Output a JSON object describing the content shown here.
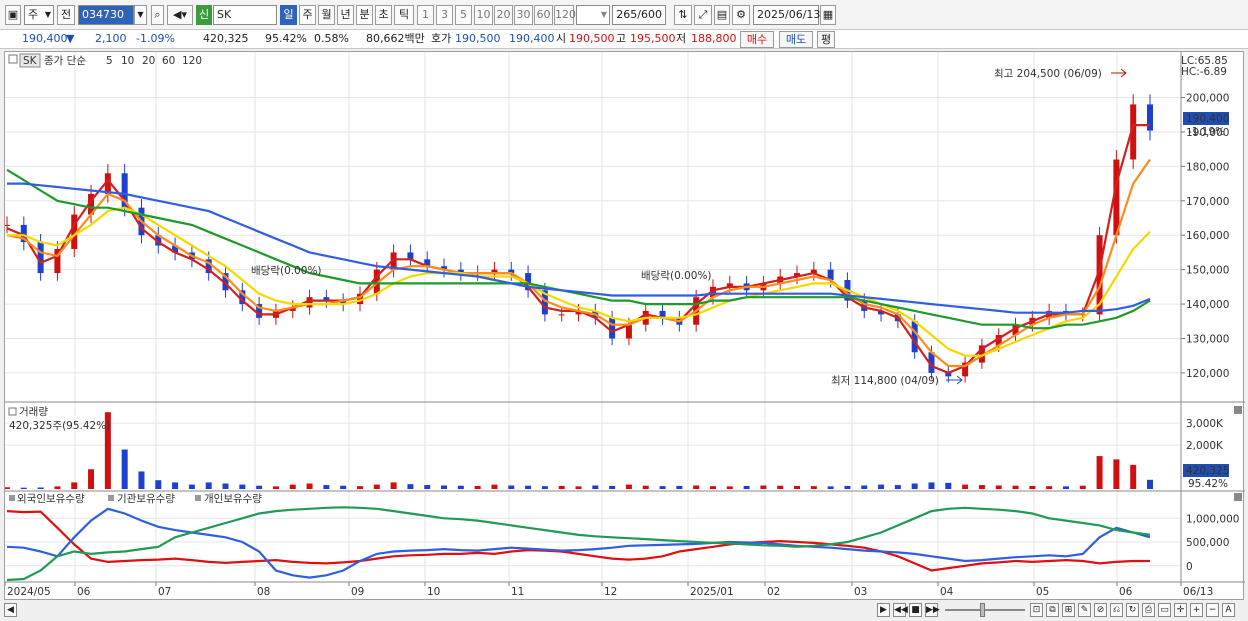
{
  "toolbar": {
    "period_type": "주",
    "prev_label": "전",
    "stock_code": "034730",
    "stock_name": "SK",
    "new_badge": "신",
    "period_buttons": [
      "일",
      "주",
      "월",
      "년",
      "분",
      "초",
      "틱"
    ],
    "interval_buttons": [
      "1",
      "3",
      "5",
      "10",
      "20",
      "30",
      "60",
      "120"
    ],
    "count_value": "265",
    "count_total": "/600",
    "date": "2025/06/13"
  },
  "info": {
    "price": "190,400",
    "change": "▼",
    "change_amount": "2,100",
    "change_pct": "-1.09%",
    "volume": "420,325",
    "volume_ratio": "95.42%",
    "turnover_rate": "0.58%",
    "amount": "80,662백만",
    "bid_label": "호가",
    "bid1": "190,500",
    "bid2": "190,400",
    "open_label": "시",
    "open": "190,500",
    "high_label": "고",
    "high": "195,500",
    "low_label": "저",
    "low": "188,800",
    "buy_button": "매수",
    "sell_button": "매도",
    "eval_button": "평"
  },
  "price_panel": {
    "legend_box": "SK",
    "legend_title": "종가 단순",
    "ma_periods": [
      "5",
      "10",
      "20",
      "60",
      "120"
    ],
    "lc": "LC:65.85",
    "hc": "HC:-6.89",
    "current_price": "190,400",
    "current_pct": "-1.19%",
    "max_label": "최고 204,500 (06/09)",
    "min_label": "최저 114,800 (04/09)",
    "dividend_labels": [
      "배당락(0.00%)",
      "배당락(0.00%)"
    ]
  },
  "volume_panel": {
    "title": "거래량",
    "value": "420,325주(95.42%)",
    "current": "420,325",
    "current_pct": "95.42%"
  },
  "holdings_panel": {
    "series_names": [
      "외국인보유수량",
      "기관보유수량",
      "개인보유수량"
    ]
  },
  "x_labels": [
    "2024/05",
    "06",
    "07",
    "08",
    "09",
    "10",
    "11",
    "12",
    "2025/01",
    "02",
    "03",
    "04",
    "05",
    "06",
    "06/13"
  ],
  "chart_data": [
    {
      "type": "line",
      "yticks": [
        "200,000",
        "190,000",
        "180,000",
        "170,000",
        "160,000",
        "150,000",
        "140,000",
        "130,000",
        "120,000"
      ],
      "ylim": [
        113000,
        208000
      ],
      "series": [
        {
          "name": "종가",
          "color": "#1e40d0",
          "values": [
            163000,
            158000,
            149000,
            156000,
            166000,
            172000,
            178000,
            168000,
            160000,
            157000,
            155000,
            153000,
            149000,
            144000,
            140000,
            136000,
            138000,
            139000,
            142000,
            141000,
            140000,
            143000,
            150000,
            155000,
            153000,
            151000,
            150000,
            149000,
            149000,
            150000,
            149000,
            144000,
            137000,
            137000,
            138000,
            136000,
            130000,
            134000,
            138000,
            136000,
            134000,
            142000,
            145000,
            146000,
            144000,
            146000,
            148000,
            149000,
            150000,
            147000,
            141000,
            138000,
            137000,
            135000,
            126000,
            120000,
            119000,
            123000,
            128000,
            131000,
            134000,
            136000,
            138000,
            137000,
            137000,
            160000,
            182000,
            198000,
            190400
          ]
        },
        {
          "name": "5",
          "color": "#d02020",
          "values": [
            162000,
            160000,
            152000,
            154000,
            163000,
            170000,
            176000,
            170000,
            162000,
            158000,
            155000,
            153000,
            150000,
            146000,
            141000,
            137000,
            137000,
            139000,
            141000,
            141000,
            141000,
            142000,
            148000,
            153000,
            153000,
            151000,
            150000,
            149000,
            149000,
            149000,
            149000,
            145000,
            139000,
            138000,
            138000,
            136000,
            132000,
            134000,
            137000,
            136000,
            135000,
            140000,
            144000,
            145000,
            145000,
            146000,
            147000,
            148000,
            149000,
            147000,
            142000,
            139000,
            138000,
            136000,
            129000,
            122000,
            120000,
            122000,
            127000,
            130000,
            133000,
            135000,
            137000,
            137000,
            137000,
            150000,
            175000,
            192000,
            192000
          ]
        },
        {
          "name": "10",
          "color": "#ff8c1a",
          "values": [
            160000,
            159000,
            155000,
            154000,
            160000,
            166000,
            172000,
            170000,
            164000,
            160000,
            157000,
            154000,
            152000,
            148000,
            143000,
            139000,
            138000,
            139000,
            140000,
            140000,
            141000,
            142000,
            146000,
            150000,
            151000,
            151000,
            150000,
            149000,
            149000,
            149000,
            149000,
            146000,
            141000,
            139000,
            138000,
            137000,
            134000,
            134000,
            136000,
            136000,
            135000,
            138000,
            142000,
            144000,
            145000,
            145000,
            146000,
            147000,
            148000,
            147000,
            143000,
            140000,
            139000,
            137000,
            132000,
            126000,
            122000,
            122000,
            125000,
            128000,
            131000,
            134000,
            136000,
            137000,
            137000,
            145000,
            160000,
            175000,
            182000
          ]
        },
        {
          "name": "20",
          "color": "#f5d800",
          "values": [
            160000,
            160000,
            158000,
            157000,
            160000,
            163000,
            167000,
            168000,
            166000,
            163000,
            160000,
            157000,
            154000,
            151000,
            147000,
            143000,
            141000,
            140000,
            140000,
            140000,
            140000,
            141000,
            143000,
            146000,
            148000,
            149000,
            149000,
            149000,
            148000,
            148000,
            148000,
            146000,
            143000,
            141000,
            139000,
            138000,
            136000,
            135000,
            136000,
            136000,
            136000,
            137000,
            139000,
            141000,
            142000,
            143000,
            144000,
            145000,
            146000,
            146000,
            144000,
            142000,
            140000,
            138000,
            135000,
            131000,
            127000,
            125000,
            125000,
            127000,
            129000,
            131000,
            133000,
            135000,
            136000,
            140000,
            148000,
            156000,
            161000
          ]
        },
        {
          "name": "60",
          "color": "#1f9a2a",
          "values": [
            179000,
            176000,
            173000,
            170000,
            169000,
            168000,
            168000,
            167000,
            166000,
            165000,
            164000,
            163000,
            161000,
            159000,
            157000,
            155000,
            153000,
            151000,
            149000,
            148000,
            147000,
            146000,
            146000,
            146000,
            146000,
            146000,
            146000,
            146000,
            146000,
            146000,
            146000,
            146000,
            145000,
            144000,
            143000,
            142000,
            141000,
            141000,
            140000,
            140000,
            140000,
            140000,
            141000,
            141000,
            142000,
            142000,
            142000,
            142000,
            142000,
            142000,
            142000,
            141000,
            140000,
            139000,
            138000,
            137000,
            136000,
            135000,
            134000,
            134000,
            134000,
            133000,
            133000,
            134000,
            134000,
            135000,
            136000,
            138000,
            141000
          ]
        },
        {
          "name": "120",
          "color": "#2f5fe0",
          "values": [
            175000,
            175000,
            174500,
            174000,
            173500,
            173000,
            172500,
            172000,
            171000,
            170000,
            169000,
            168000,
            167000,
            165000,
            163000,
            161000,
            159000,
            157000,
            155000,
            154000,
            153000,
            152000,
            151000,
            150500,
            150000,
            149500,
            149000,
            148500,
            148000,
            147000,
            146000,
            145000,
            144500,
            144000,
            143500,
            143000,
            142500,
            142500,
            142500,
            142500,
            142500,
            142500,
            143000,
            143000,
            143000,
            143000,
            143000,
            143000,
            143000,
            143000,
            142500,
            142000,
            141500,
            141000,
            140500,
            140000,
            139500,
            139000,
            138500,
            138000,
            137500,
            137500,
            137500,
            137500,
            138000,
            138000,
            138500,
            139500,
            141500
          ]
        }
      ]
    },
    {
      "type": "bar",
      "ylabel": "거래량",
      "yticks": [
        "3,000K",
        "2,000K"
      ],
      "ylim": [
        0,
        3600
      ],
      "unit": "K",
      "values": [
        80,
        60,
        70,
        120,
        300,
        900,
        3500,
        1800,
        800,
        400,
        300,
        200,
        300,
        250,
        200,
        150,
        120,
        200,
        250,
        180,
        150,
        130,
        200,
        300,
        220,
        180,
        160,
        150,
        140,
        200,
        160,
        150,
        130,
        140,
        120,
        160,
        140,
        200,
        150,
        130,
        140,
        160,
        130,
        120,
        140,
        160,
        150,
        140,
        130,
        120,
        140,
        160,
        200,
        180,
        250,
        300,
        280,
        200,
        180,
        160,
        150,
        140,
        130,
        120,
        150,
        1500,
        1350,
        1100,
        420
      ]
    },
    {
      "type": "line",
      "yticks": [
        "1,000,000",
        "500,000",
        "0"
      ],
      "ylim": [
        -300000,
        1300000
      ],
      "series": [
        {
          "name": "외국인보유수량",
          "color": "#e01010",
          "values": [
            1150000,
            1130000,
            1140000,
            800000,
            450000,
            150000,
            80000,
            100000,
            120000,
            130000,
            150000,
            120000,
            80000,
            60000,
            80000,
            100000,
            120000,
            80000,
            60000,
            50000,
            70000,
            100000,
            150000,
            200000,
            220000,
            230000,
            250000,
            250000,
            270000,
            250000,
            300000,
            330000,
            320000,
            300000,
            250000,
            200000,
            150000,
            130000,
            150000,
            200000,
            300000,
            350000,
            400000,
            450000,
            480000,
            500000,
            520000,
            500000,
            480000,
            450000,
            420000,
            380000,
            300000,
            200000,
            50000,
            -100000,
            -50000,
            0,
            50000,
            70000,
            100000,
            80000,
            100000,
            120000,
            100000,
            50000,
            80000,
            100000,
            100000
          ]
        },
        {
          "name": "기관보유수량",
          "color": "#2f5fe0",
          "values": [
            400000,
            380000,
            300000,
            200000,
            600000,
            950000,
            1200000,
            1100000,
            950000,
            820000,
            750000,
            700000,
            650000,
            600000,
            500000,
            300000,
            -100000,
            -200000,
            -250000,
            -200000,
            -100000,
            100000,
            250000,
            300000,
            320000,
            330000,
            350000,
            330000,
            320000,
            350000,
            380000,
            360000,
            340000,
            320000,
            330000,
            350000,
            380000,
            420000,
            430000,
            440000,
            450000,
            460000,
            480000,
            500000,
            490000,
            480000,
            450000,
            420000,
            400000,
            380000,
            350000,
            320000,
            300000,
            280000,
            250000,
            200000,
            150000,
            100000,
            120000,
            150000,
            180000,
            200000,
            220000,
            200000,
            250000,
            600000,
            800000,
            700000,
            600000
          ]
        },
        {
          "name": "개인보유수량",
          "color": "#229955",
          "values": [
            -300000,
            -280000,
            -100000,
            200000,
            300000,
            250000,
            280000,
            300000,
            350000,
            400000,
            600000,
            700000,
            800000,
            900000,
            1000000,
            1100000,
            1150000,
            1180000,
            1200000,
            1220000,
            1230000,
            1220000,
            1200000,
            1150000,
            1100000,
            1050000,
            1000000,
            980000,
            950000,
            900000,
            850000,
            800000,
            750000,
            700000,
            650000,
            620000,
            600000,
            580000,
            560000,
            540000,
            520000,
            500000,
            480000,
            470000,
            450000,
            430000,
            420000,
            400000,
            420000,
            450000,
            500000,
            600000,
            700000,
            850000,
            1000000,
            1150000,
            1200000,
            1220000,
            1200000,
            1180000,
            1150000,
            1100000,
            1000000,
            950000,
            900000,
            850000,
            750000,
            700000,
            650000
          ]
        }
      ]
    }
  ]
}
